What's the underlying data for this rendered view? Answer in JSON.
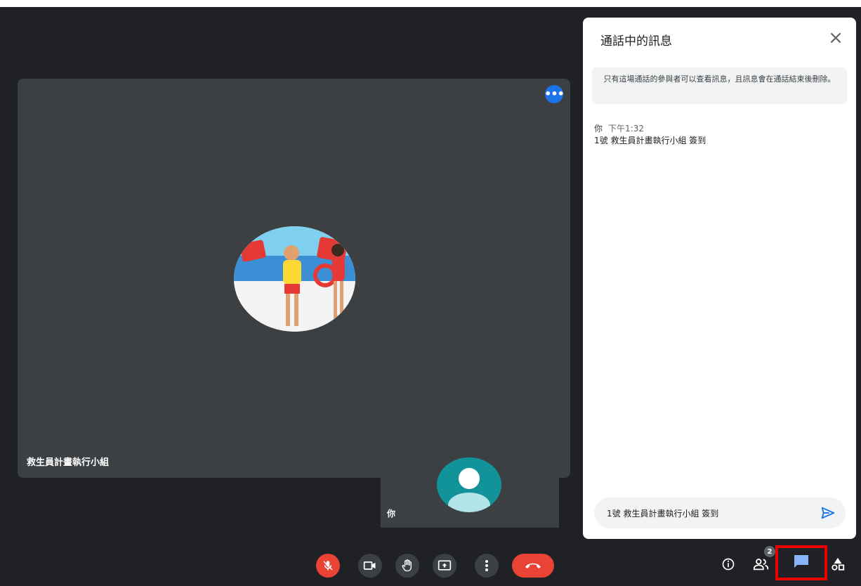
{
  "main_tile": {
    "participant_name": "救生員計畫執行小組",
    "more_options_icon": "more-horiz-icon"
  },
  "self_tile": {
    "name": "你"
  },
  "chat": {
    "title": "通話中的訊息",
    "close_icon": "close-icon",
    "notice": "只有這場通話的參與者可以查看訊息，且訊息會在通話結束後刪除。",
    "messages": [
      {
        "sender": "你",
        "time": "下午1:32",
        "text": "1號 救生員計畫執行小組 簽到"
      }
    ],
    "input_value": "1號 救生員計畫執行小組 簽到",
    "send_icon": "send-icon"
  },
  "controls": {
    "mic": "mic-off-icon",
    "camera": "videocam-icon",
    "raise_hand": "hand-icon",
    "present": "present-screen-icon",
    "more": "more-vert-icon",
    "leave": "call-end-icon",
    "mic_color": "#ea4335",
    "leave_color": "#ea4335"
  },
  "side_controls": {
    "info": "info-icon",
    "people": "people-icon",
    "people_count": "2",
    "chat": "chat-icon",
    "activities": "activities-icon",
    "chat_active_color": "#8ab4f8"
  }
}
